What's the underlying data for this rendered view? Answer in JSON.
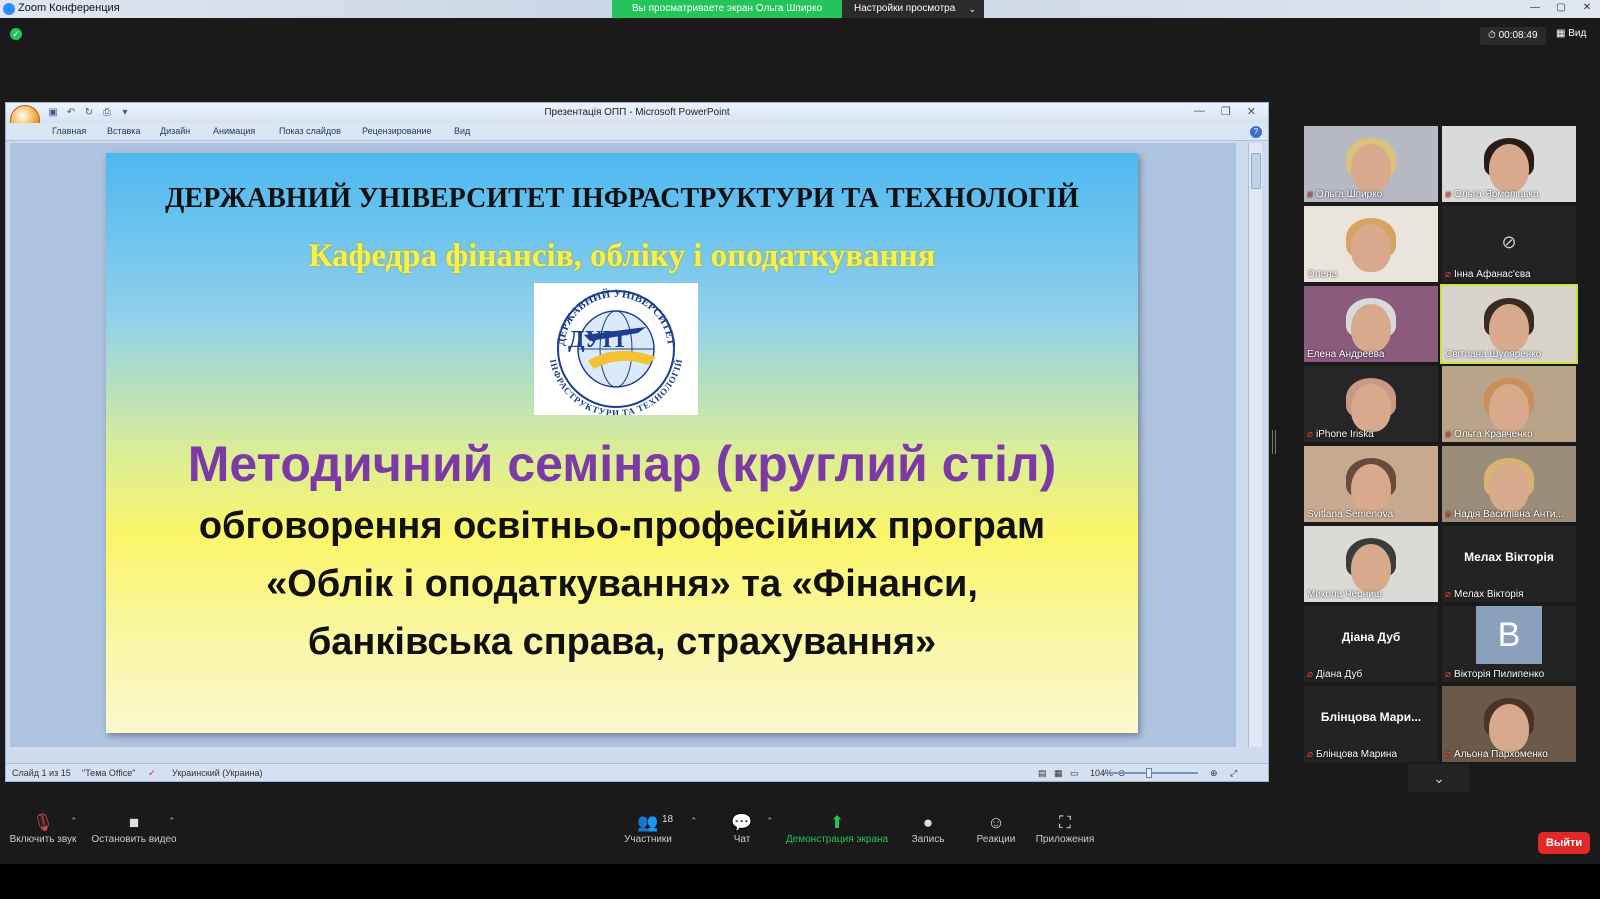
{
  "zoom": {
    "window_title": "Zoom Конференция",
    "share_banner": "Вы просматриваете экран Ольга Шпирко",
    "view_options": "Настройки просмотра",
    "timer": "00:08:49",
    "view_label": "Вид",
    "leave_label": "Выйти"
  },
  "ppt": {
    "title": "Презентація ОПП - Microsoft PowerPoint",
    "ribbon_tabs": [
      "Главная",
      "Вставка",
      "Дизайн",
      "Анимация",
      "Показ слайдов",
      "Рецензирование",
      "Вид"
    ],
    "status": {
      "slide": "Слайд 1 из 15",
      "theme": "\"Тема Office\"",
      "language": "Украинский (Украина)",
      "zoom": "104%"
    }
  },
  "slide": {
    "university": "ДЕРЖАВНИЙ УНІВЕРСИТЕТ ІНФРАСТРУКТУРИ ТА ТЕХНОЛОГІЙ",
    "department": "Кафедра фінансів, обліку і оподаткування",
    "logo_text": "ДУІТ",
    "logo_ring_top": "ДЕРЖАВНИЙ УНІВЕРСИТЕТ",
    "logo_ring_bottom": "ІНФРАСТРУКТУРИ ТА ТЕХНОЛОГІЙ",
    "seminar": "Методичний семінар (круглий стіл)",
    "subtitle_lines": [
      "обговорення освітньо-професійних програм",
      "«Облік і оподаткування» та «Фінанси,",
      "банківська справа, страхування»"
    ]
  },
  "participants": [
    {
      "name": "Ольга Шпирко",
      "muted": true,
      "kind": "video",
      "bg": "#b7b9c4",
      "hair": "#d9c27a",
      "active": false
    },
    {
      "name": "Ольга Ярмоліцька",
      "muted": true,
      "kind": "video",
      "bg": "#dadada",
      "hair": "#2a1d18",
      "active": false
    },
    {
      "name": "Олена",
      "muted": false,
      "kind": "video",
      "bg": "#e9e4dc",
      "hair": "#d7a360",
      "active": false
    },
    {
      "name": "Інна Афанас'єва",
      "muted": true,
      "kind": "nocam",
      "bg": "#232323",
      "active": false
    },
    {
      "name": "Елена Андреева",
      "muted": false,
      "kind": "video",
      "bg": "#8a5b7c",
      "hair": "#d9d9d9",
      "active": false
    },
    {
      "name": "Світлана Шуляренко",
      "muted": false,
      "kind": "video",
      "bg": "#d8d3cb",
      "hair": "#3a2a22",
      "active": true
    },
    {
      "name": "iPhone Iriska",
      "muted": true,
      "kind": "video",
      "bg": "#262626",
      "hair": "#c89a86",
      "active": false
    },
    {
      "name": "Ольга Кравченко",
      "muted": true,
      "kind": "video",
      "bg": "#b9a489",
      "hair": "#c98f5d",
      "active": false
    },
    {
      "name": "Svitlana Semenova",
      "muted": false,
      "kind": "video",
      "bg": "#c7a990",
      "hair": "#6a4b3a",
      "active": false
    },
    {
      "name": "Надія Василівна Анти...",
      "muted": true,
      "kind": "video",
      "bg": "#9c8c7a",
      "hair": "#d8b275",
      "active": false
    },
    {
      "name": "Микола Черниш",
      "muted": false,
      "kind": "video",
      "bg": "#dcdad6",
      "hair": "#3b3b3b",
      "active": false
    },
    {
      "name": "Мелах Вікторія",
      "muted": true,
      "kind": "name",
      "bg": "#232323",
      "active": false
    },
    {
      "name": "Діана Дуб",
      "muted": true,
      "kind": "name",
      "bg": "#232323",
      "active": false
    },
    {
      "name": "Вікторія Пилипенко",
      "muted": true,
      "kind": "letter",
      "letter": "B",
      "bg": "#232323",
      "active": false
    },
    {
      "name": "Блінцова Марина",
      "center": "Блінцова Мари...",
      "muted": true,
      "kind": "name",
      "bg": "#232323",
      "active": false
    },
    {
      "name": "Альона Пархоменко",
      "muted": true,
      "kind": "video",
      "bg": "#6b5a4a",
      "hair": "#4b3326",
      "active": false
    }
  ],
  "toolbar": {
    "unmute": "Включить звук",
    "stop_video": "Остановить видео",
    "participants": "Участники",
    "participants_count": "18",
    "chat": "Чат",
    "share": "Демонстрация экрана",
    "record": "Запись",
    "reactions": "Реакции",
    "apps": "Приложения"
  }
}
